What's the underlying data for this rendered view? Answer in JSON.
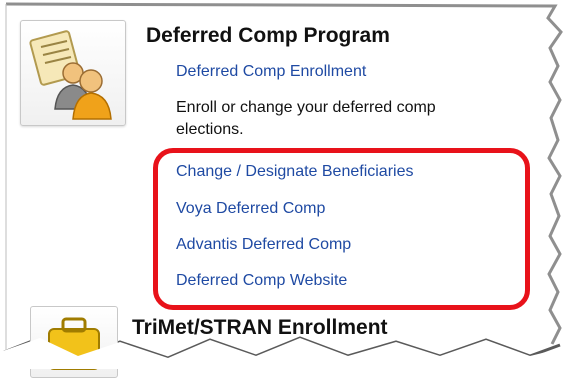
{
  "section1": {
    "title": "Deferred Comp Program",
    "icon": "document-people-icon",
    "links": [
      "Deferred Comp Enrollment",
      "Change / Designate Beneficiaries",
      "Voya Deferred Comp",
      "Advantis Deferred Comp",
      "Deferred Comp Website"
    ],
    "description_line1": "Enroll or change your deferred comp",
    "description_line2": "elections."
  },
  "section2": {
    "title": "TriMet/STRAN Enrollment",
    "icon": "briefcase-icon"
  },
  "highlight_color": "#e8121a",
  "link_color": "#1f4aa3"
}
